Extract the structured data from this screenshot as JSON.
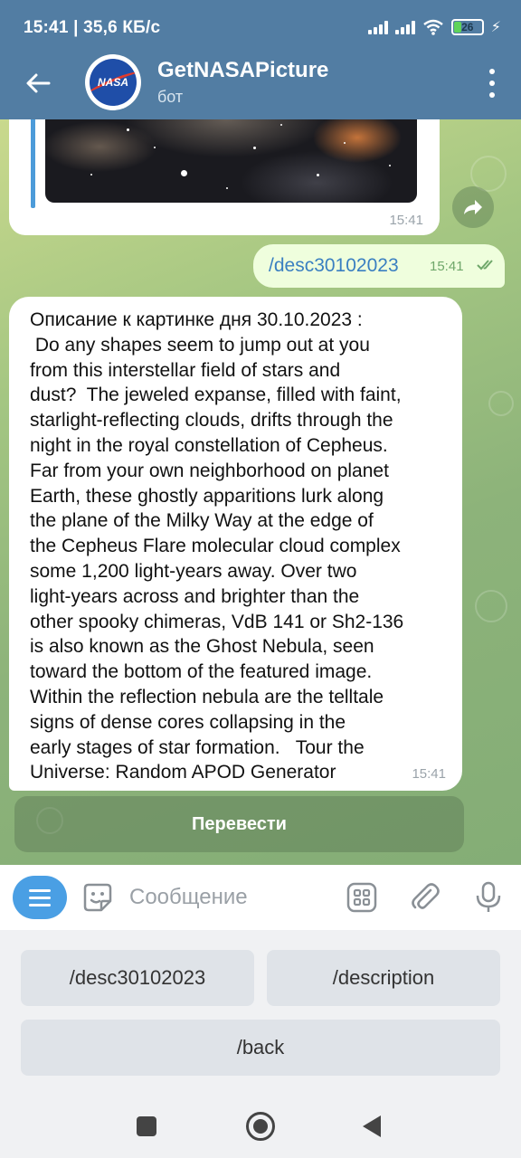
{
  "status_bar": {
    "time_speed": "15:41 | 35,6 КБ/с",
    "battery_level": "26",
    "icons": [
      "signal-icon",
      "signal-icon",
      "wifi-icon",
      "battery-icon",
      "charging-icon"
    ]
  },
  "header": {
    "title": "GetNASAPicture",
    "subtitle": "бот",
    "avatar_text": "NASA"
  },
  "messages": {
    "image_message": {
      "time": "15:41"
    },
    "outgoing": {
      "text": "/desc30102023",
      "time": "15:41"
    },
    "incoming": {
      "lines": [
        "Описание к картинке дня 30.10.2023 :",
        " Do any shapes seem to jump out at you",
        "from this interstellar field of stars and",
        "dust?  The jeweled expanse, filled with faint,",
        "starlight-reflecting clouds, drifts through the",
        "night in the royal constellation of Cepheus.",
        "Far from your own neighborhood on planet",
        "Earth, these ghostly apparitions lurk along",
        "the plane of the Milky Way at the edge of",
        "the Cepheus Flare molecular cloud complex",
        "some 1,200 light-years away. Over two",
        "light-years across and brighter than the",
        "other spooky chimeras, VdB 141 or Sh2-136",
        "is also known as the Ghost Nebula, seen",
        "toward the bottom of the featured image.",
        "Within the reflection nebula are the telltale",
        "signs of dense cores collapsing in the",
        "early stages of star formation.   Tour the",
        "Universe: Random APOD Generator"
      ],
      "time": "15:41"
    },
    "inline_button": "Перевести"
  },
  "input": {
    "placeholder": "Сообщение"
  },
  "reply_keyboard": {
    "buttons": [
      "/desc30102023",
      "/description",
      "/back"
    ]
  },
  "colors": {
    "header_bg": "#527da3",
    "accent_blue": "#4a9fe4",
    "outgoing_bubble": "#effedd"
  }
}
